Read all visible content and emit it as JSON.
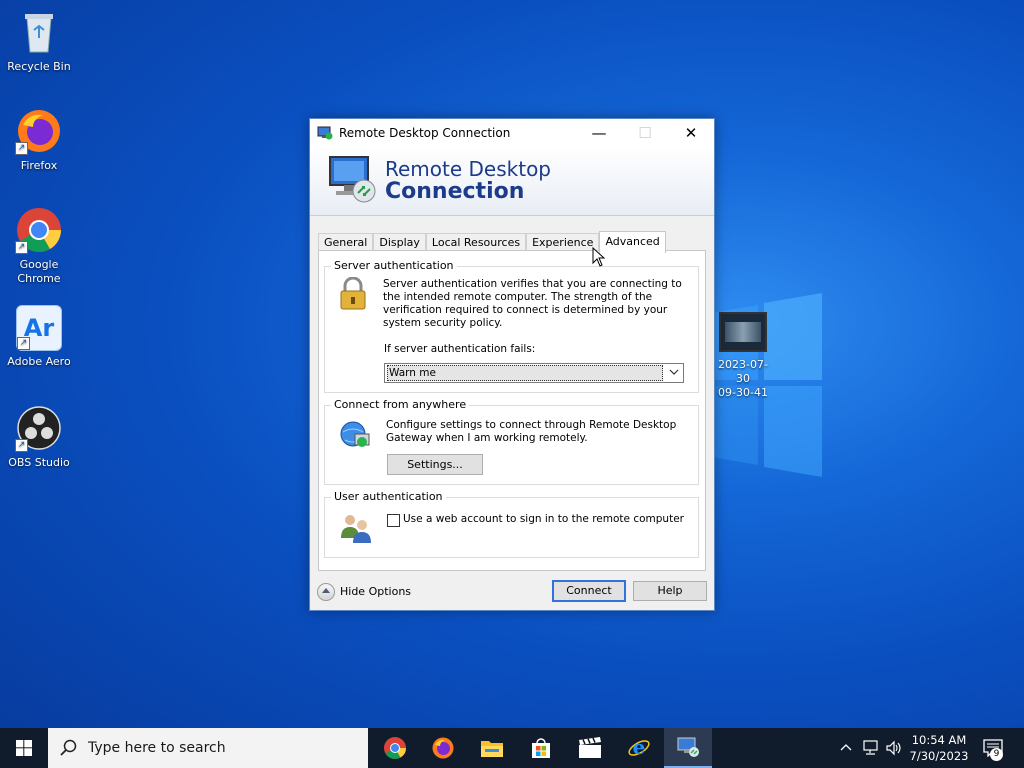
{
  "desktop": {
    "icons": [
      {
        "label": "Recycle Bin"
      },
      {
        "label": "Firefox"
      },
      {
        "label": "Google Chrome"
      },
      {
        "label": "Adobe Aero",
        "glyph": "Ar"
      },
      {
        "label": "OBS Studio"
      }
    ],
    "video_file": {
      "line1": "2023-07-30",
      "line2": "09-30-41"
    }
  },
  "dialog": {
    "title": "Remote Desktop Connection",
    "banner_line1": "Remote Desktop",
    "banner_line2": "Connection",
    "window_controls": {
      "minimize": "—",
      "maximize": "☐",
      "close": "✕"
    },
    "tabs": [
      {
        "label": "General"
      },
      {
        "label": "Display"
      },
      {
        "label": "Local Resources"
      },
      {
        "label": "Experience"
      },
      {
        "label": "Advanced",
        "active": true
      }
    ],
    "server_auth": {
      "title": "Server authentication",
      "description": "Server authentication verifies that you are connecting to the intended remote computer. The strength of the verification required to connect is determined by your system security policy.",
      "fails_label": "If server authentication fails:",
      "selected_option": "Warn me"
    },
    "connect_anywhere": {
      "title": "Connect from anywhere",
      "description": "Configure settings to connect through Remote Desktop Gateway when I am working remotely.",
      "settings_button": "Settings..."
    },
    "user_auth": {
      "title": "User authentication",
      "checkbox_label": "Use a web account to sign in to the remote computer",
      "checked": false
    },
    "footer": {
      "hide_options": "Hide Options",
      "connect_button": "Connect",
      "help_button": "Help"
    }
  },
  "taskbar": {
    "search_placeholder": "Type here to search",
    "apps": [
      "chrome-icon",
      "firefox-icon",
      "file-explorer-icon",
      "store-icon",
      "movie-maker-icon",
      "internet-explorer-icon",
      "remote-desktop-icon"
    ],
    "clock_time": "10:54 AM",
    "clock_date": "7/30/2023",
    "notification_count": "9"
  },
  "colors": {
    "desktop_blue": "#0a4fc0",
    "banner_text": "#1c3b8a",
    "default_button_border": "#2f74d6",
    "taskbar": "#101c2c"
  }
}
